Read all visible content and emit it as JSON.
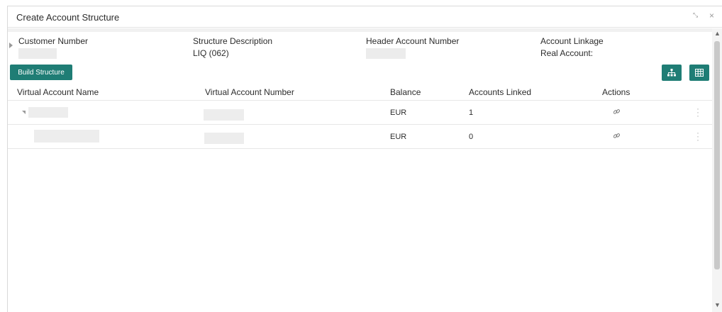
{
  "window": {
    "title": "Create Account Structure",
    "minimize_glyph": "⤡",
    "close_glyph": "×"
  },
  "header": {
    "customer_number": {
      "label": "Customer Number",
      "value": ""
    },
    "structure_description": {
      "label": "Structure Description",
      "value": "LIQ (062)"
    },
    "header_account_number": {
      "label": "Header Account Number",
      "value": ""
    },
    "account_linkage": {
      "label": "Account Linkage",
      "value": "Real Account:"
    }
  },
  "toolbar": {
    "build_structure_label": "Build Structure",
    "hierarchy_view_icon": "hierarchy-icon",
    "grid_view_icon": "grid-icon"
  },
  "table": {
    "columns": [
      "Virtual Account Name",
      "Virtual Account Number",
      "Balance",
      "Accounts Linked",
      "Actions"
    ],
    "rows": [
      {
        "name": "",
        "number": "",
        "balance": "EUR",
        "accounts_linked": "1",
        "action_icon": "link-icon",
        "expanded": true
      },
      {
        "name": "",
        "number": "",
        "balance": "EUR",
        "accounts_linked": "0",
        "action_icon": "link-icon",
        "expanded": false
      }
    ]
  },
  "colors": {
    "accent": "#1f7d75",
    "masked": "#ececec",
    "border": "#e7e7e7"
  }
}
